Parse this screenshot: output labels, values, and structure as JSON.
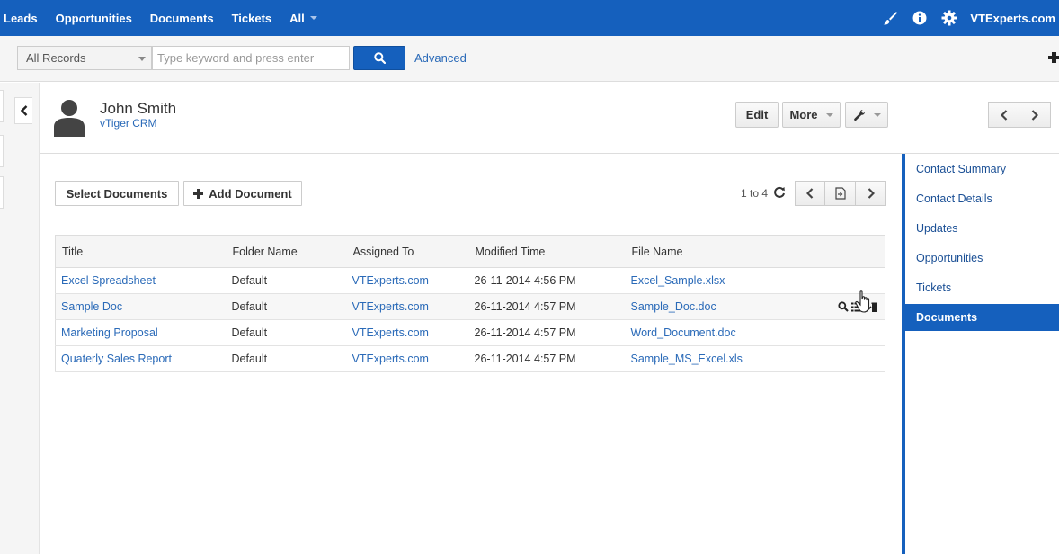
{
  "topnav": {
    "items": [
      {
        "label": "Leads"
      },
      {
        "label": "Opportunities"
      },
      {
        "label": "Documents"
      },
      {
        "label": "Tickets"
      },
      {
        "label": "All"
      }
    ],
    "user": "VTExperts.com",
    "icons": [
      "paint-brush-icon",
      "info-icon",
      "gear-icon"
    ]
  },
  "search": {
    "records_select": "All Records",
    "placeholder": "Type keyword and press enter",
    "advanced_label": "Advanced"
  },
  "record": {
    "name": "John Smith",
    "subtitle": "vTiger CRM",
    "edit_label": "Edit",
    "more_label": "More"
  },
  "documents": {
    "select_label": "Select Documents",
    "add_label": "Add Document",
    "pagination": "1 to 4",
    "columns": [
      "Title",
      "Folder Name",
      "Assigned To",
      "Modified Time",
      "File Name"
    ],
    "rows": [
      {
        "title": "Excel Spreadsheet",
        "folder": "Default",
        "assigned": "VTExperts.com",
        "modified": "26-11-2014 4:56 PM",
        "file": "Excel_Sample.xlsx"
      },
      {
        "title": "Sample Doc",
        "folder": "Default",
        "assigned": "VTExperts.com",
        "modified": "26-11-2014 4:57 PM",
        "file": "Sample_Doc.doc"
      },
      {
        "title": "Marketing Proposal",
        "folder": "Default",
        "assigned": "VTExperts.com",
        "modified": "26-11-2014 4:57 PM",
        "file": "Word_Document.doc"
      },
      {
        "title": "Quaterly Sales Report",
        "folder": "Default",
        "assigned": "VTExperts.com",
        "modified": "26-11-2014 4:57 PM",
        "file": "Sample_MS_Excel.xls"
      }
    ]
  },
  "sidebar": {
    "items": [
      {
        "label": "Contact Summary"
      },
      {
        "label": "Contact Details"
      },
      {
        "label": "Updates"
      },
      {
        "label": "Opportunities"
      },
      {
        "label": "Tickets"
      },
      {
        "label": "Documents"
      }
    ],
    "active_index": 5
  },
  "colors": {
    "brand": "#1560bd",
    "link": "#2a6ab8"
  }
}
